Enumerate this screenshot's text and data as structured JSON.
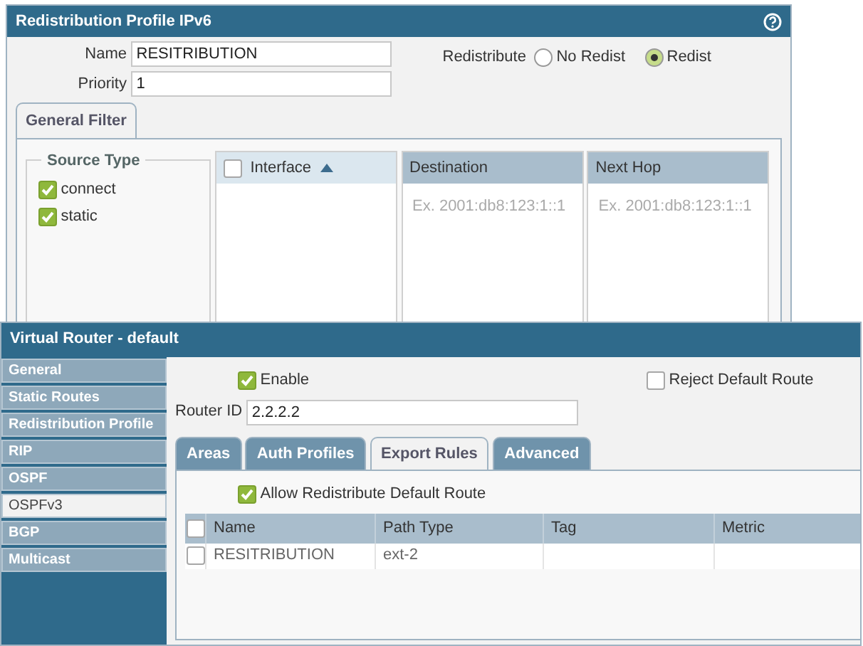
{
  "profile_dialog": {
    "title": "Redistribution Profile IPv6",
    "fields": [
      {
        "label": "Name",
        "value": "RESITRIBUTION"
      },
      {
        "label": "Priority",
        "value": "1"
      }
    ],
    "redistribute": {
      "label": "Redistribute",
      "options": [
        {
          "label": "No Redist",
          "selected": false
        },
        {
          "label": "Redist",
          "selected": true
        }
      ]
    },
    "tabs": [
      {
        "label": "General Filter",
        "selected": true
      }
    ],
    "source_type": {
      "title": "Source Type",
      "items": [
        {
          "label": "connect",
          "checked": true
        },
        {
          "label": "static",
          "checked": true
        }
      ]
    },
    "filter_columns": [
      {
        "label": "Interface",
        "kind": "list",
        "checked": false,
        "sorted": true
      },
      {
        "label": "Destination",
        "kind": "field",
        "placeholder": "Ex. 2001:db8:123:1::1"
      },
      {
        "label": "Next Hop",
        "kind": "field",
        "placeholder": "Ex. 2001:db8:123:1::1"
      }
    ]
  },
  "router_dialog": {
    "title": "Virtual Router - default",
    "nav": [
      {
        "label": "General",
        "selected": false
      },
      {
        "label": "Static Routes",
        "selected": false
      },
      {
        "label": "Redistribution Profile",
        "selected": false
      },
      {
        "label": "RIP",
        "selected": false
      },
      {
        "label": "OSPF",
        "selected": false
      },
      {
        "label": "OSPFv3",
        "selected": true
      },
      {
        "label": "BGP",
        "selected": false
      },
      {
        "label": "Multicast",
        "selected": false
      }
    ],
    "enable": {
      "label": "Enable",
      "checked": true
    },
    "reject_default": {
      "label": "Reject Default Route",
      "checked": false
    },
    "router_id": {
      "label": "Router ID",
      "value": "2.2.2.2"
    },
    "tabs": [
      {
        "label": "Areas",
        "selected": false
      },
      {
        "label": "Auth Profiles",
        "selected": false
      },
      {
        "label": "Export Rules",
        "selected": true
      },
      {
        "label": "Advanced",
        "selected": false
      }
    ],
    "allow_redistribute": {
      "label": "Allow Redistribute Default Route",
      "checked": true
    },
    "table": {
      "header_checked": false,
      "columns": [
        "Name",
        "Path Type",
        "Tag",
        "Metric"
      ],
      "rows": [
        {
          "checked": false,
          "cells": [
            "RESITRIBUTION",
            "ext-2"
          ]
        }
      ]
    }
  }
}
